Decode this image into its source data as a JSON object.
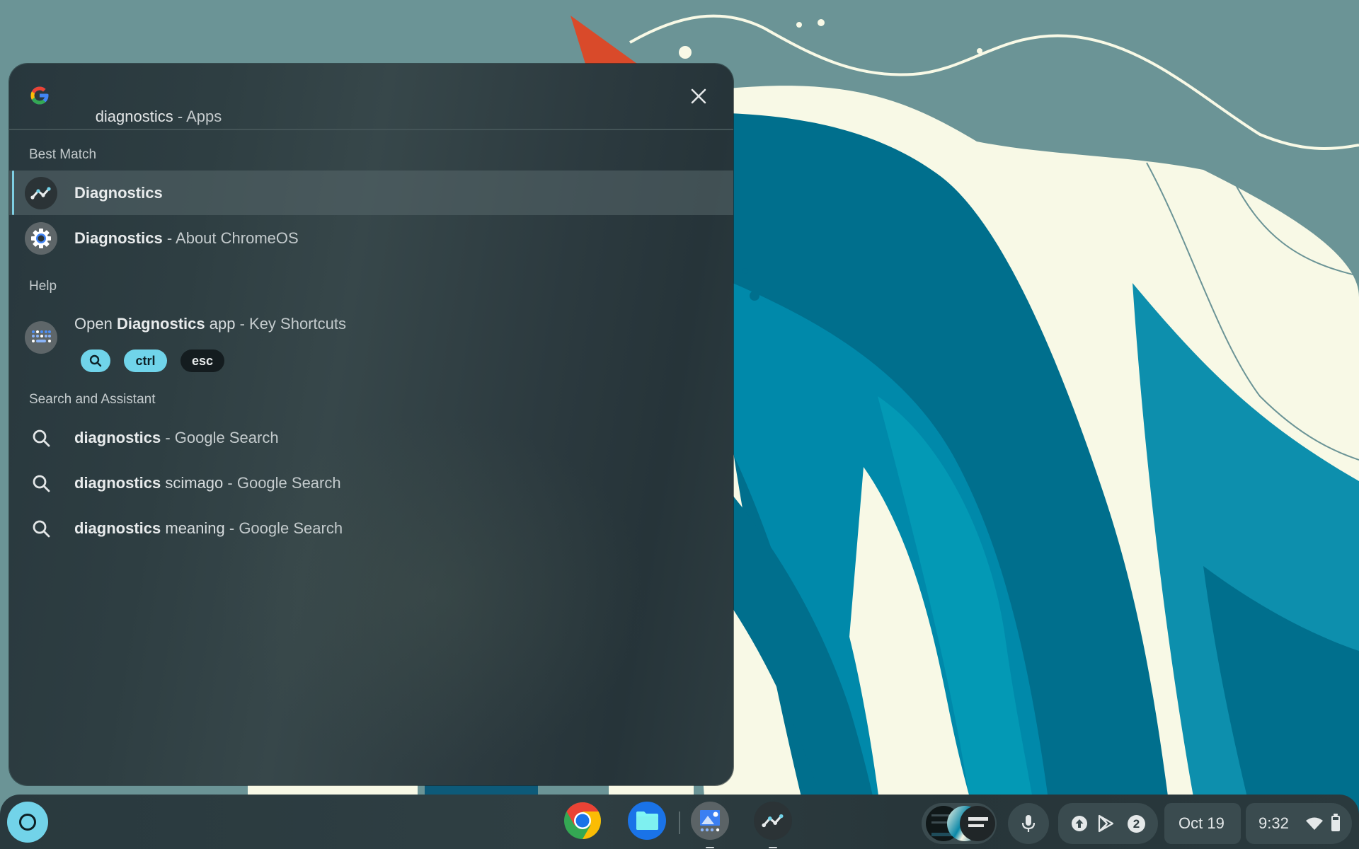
{
  "search": {
    "query": "diagnostics",
    "category": " - Apps",
    "close_label": "Close"
  },
  "sections": {
    "best_match": "Best Match",
    "help": "Help",
    "search_assistant": "Search and Assistant"
  },
  "best_match": [
    {
      "bold": "Diagnostics",
      "rest": "",
      "icon": "diagnostics-app-icon",
      "selected": true
    },
    {
      "bold": "Diagnostics",
      "rest": " - About ChromeOS",
      "icon": "settings-gear-icon",
      "selected": false
    }
  ],
  "help_result": {
    "prefix": "Open ",
    "bold": "Diagnostics",
    "suffix": " app",
    "rest": " - Key Shortcuts",
    "keys": [
      "search",
      "ctrl",
      "esc"
    ]
  },
  "search_results": [
    {
      "bold": "diagnostics",
      "normal": "",
      "rest": " - Google Search"
    },
    {
      "bold": "diagnostics",
      "normal": " scimago",
      "rest": " - Google Search"
    },
    {
      "bold": "diagnostics",
      "normal": " meaning",
      "rest": " - Google Search"
    }
  ],
  "shelf": {
    "apps": [
      "Chrome",
      "Files",
      "Gallery",
      "Diagnostics"
    ],
    "date": "Oct 19",
    "time": "9:32",
    "notification_count": "2"
  },
  "colors": {
    "accent": "#72d3e9",
    "panel_bg": "#2c3b40",
    "wallpaper_sky": "#6b9496",
    "wallpaper_cream": "#f8f9e6",
    "wallpaper_teal_dark": "#006f8d",
    "wallpaper_teal_mid": "#0089aa"
  }
}
